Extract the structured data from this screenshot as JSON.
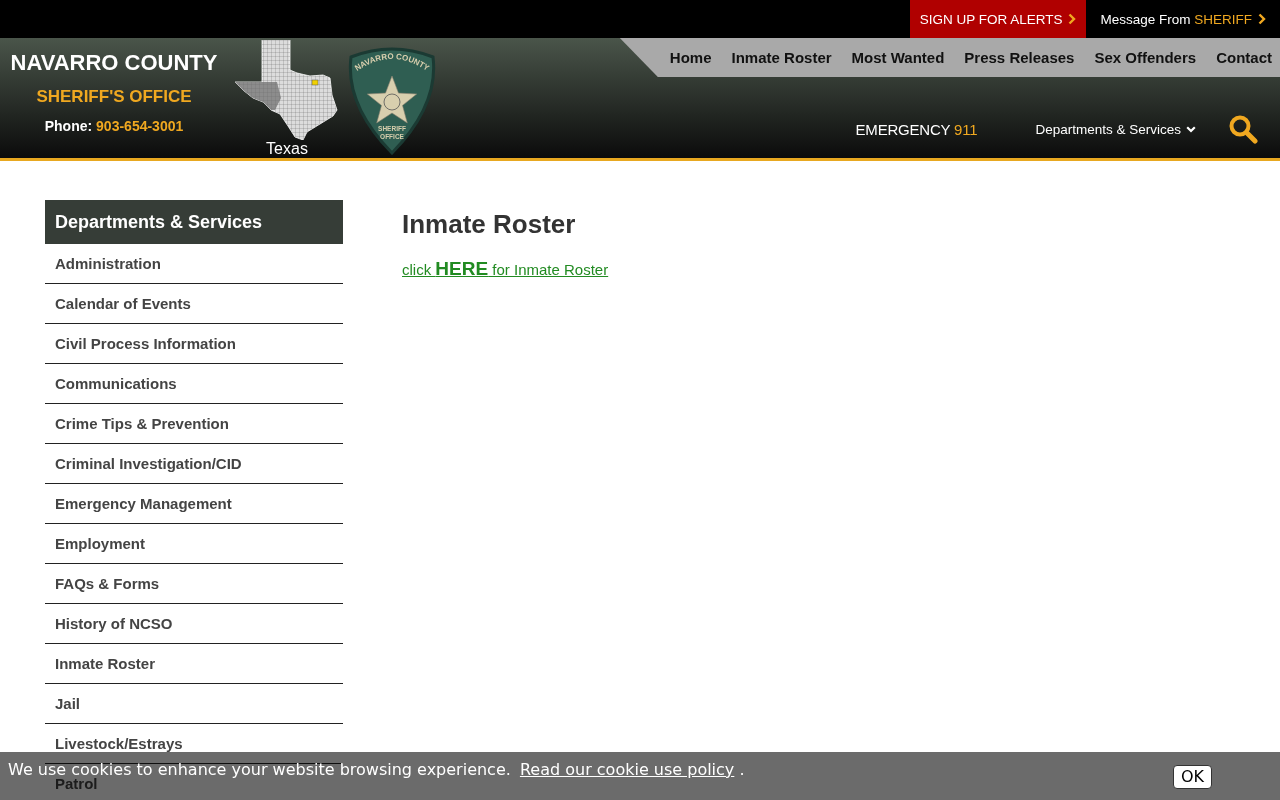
{
  "top_bar": {
    "alerts_button": "SIGN UP FOR ALERTS",
    "message_button": {
      "label": "Message From",
      "highlight": "SHERIFF"
    }
  },
  "header": {
    "title": "NAVARRO COUNTY",
    "subtitle": "SHERIFF'S OFFICE",
    "phone_label": "Phone:",
    "phone_number": "903-654-3001",
    "map_label": "Texas",
    "badge_top_text": "NAVARRO COUNTY",
    "badge_bottom_text": [
      "SHERIFF",
      "OFFICE"
    ]
  },
  "nav": {
    "items": [
      "Home",
      "Inmate Roster",
      "Most Wanted",
      "Press Releases",
      "Sex Offenders",
      "Contact"
    ]
  },
  "header_bar": {
    "emergency_label": "EMERGENCY",
    "emergency_number": "911",
    "departments_menu": "Departments & Services"
  },
  "sidebar": {
    "title": "Departments & Services",
    "items": [
      "Administration",
      "Calendar of Events",
      "Civil Process Information",
      "Communications",
      "Crime Tips & Prevention",
      "Criminal Investigation/CID",
      "Emergency Management",
      "Employment",
      "FAQs & Forms",
      "History of NCSO",
      "Inmate Roster",
      "Jail",
      "Livestock/Estrays",
      "Patrol"
    ]
  },
  "content": {
    "title": "Inmate Roster",
    "link": "click **HERE** for Inmate Roster"
  },
  "cookie_bar": {
    "message": "We use cookies to enhance your website browsing experience.",
    "policy_link": "Read our cookie use policy",
    "trailing": ".",
    "button": "OK"
  }
}
